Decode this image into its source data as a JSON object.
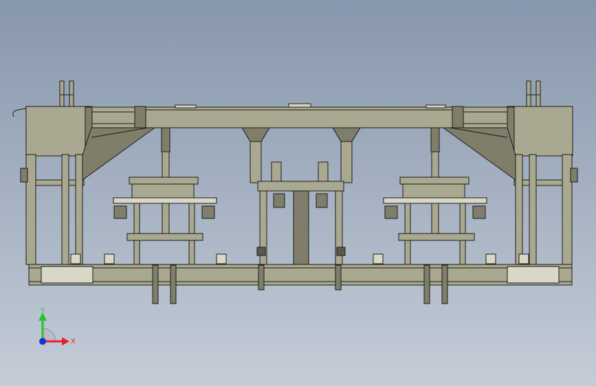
{
  "viewport": {
    "background_top": "#8797ad",
    "background_bottom": "#c4ccd7"
  },
  "model": {
    "part_color": "#a9a890",
    "part_shadow": "#7f7e6a",
    "edge_color": "#1a1a14"
  },
  "triad": {
    "x_label": "X",
    "y_label": "Y",
    "x_color": "#e8202a",
    "y_color": "#22c52a",
    "z_color": "#1a2fd8"
  }
}
